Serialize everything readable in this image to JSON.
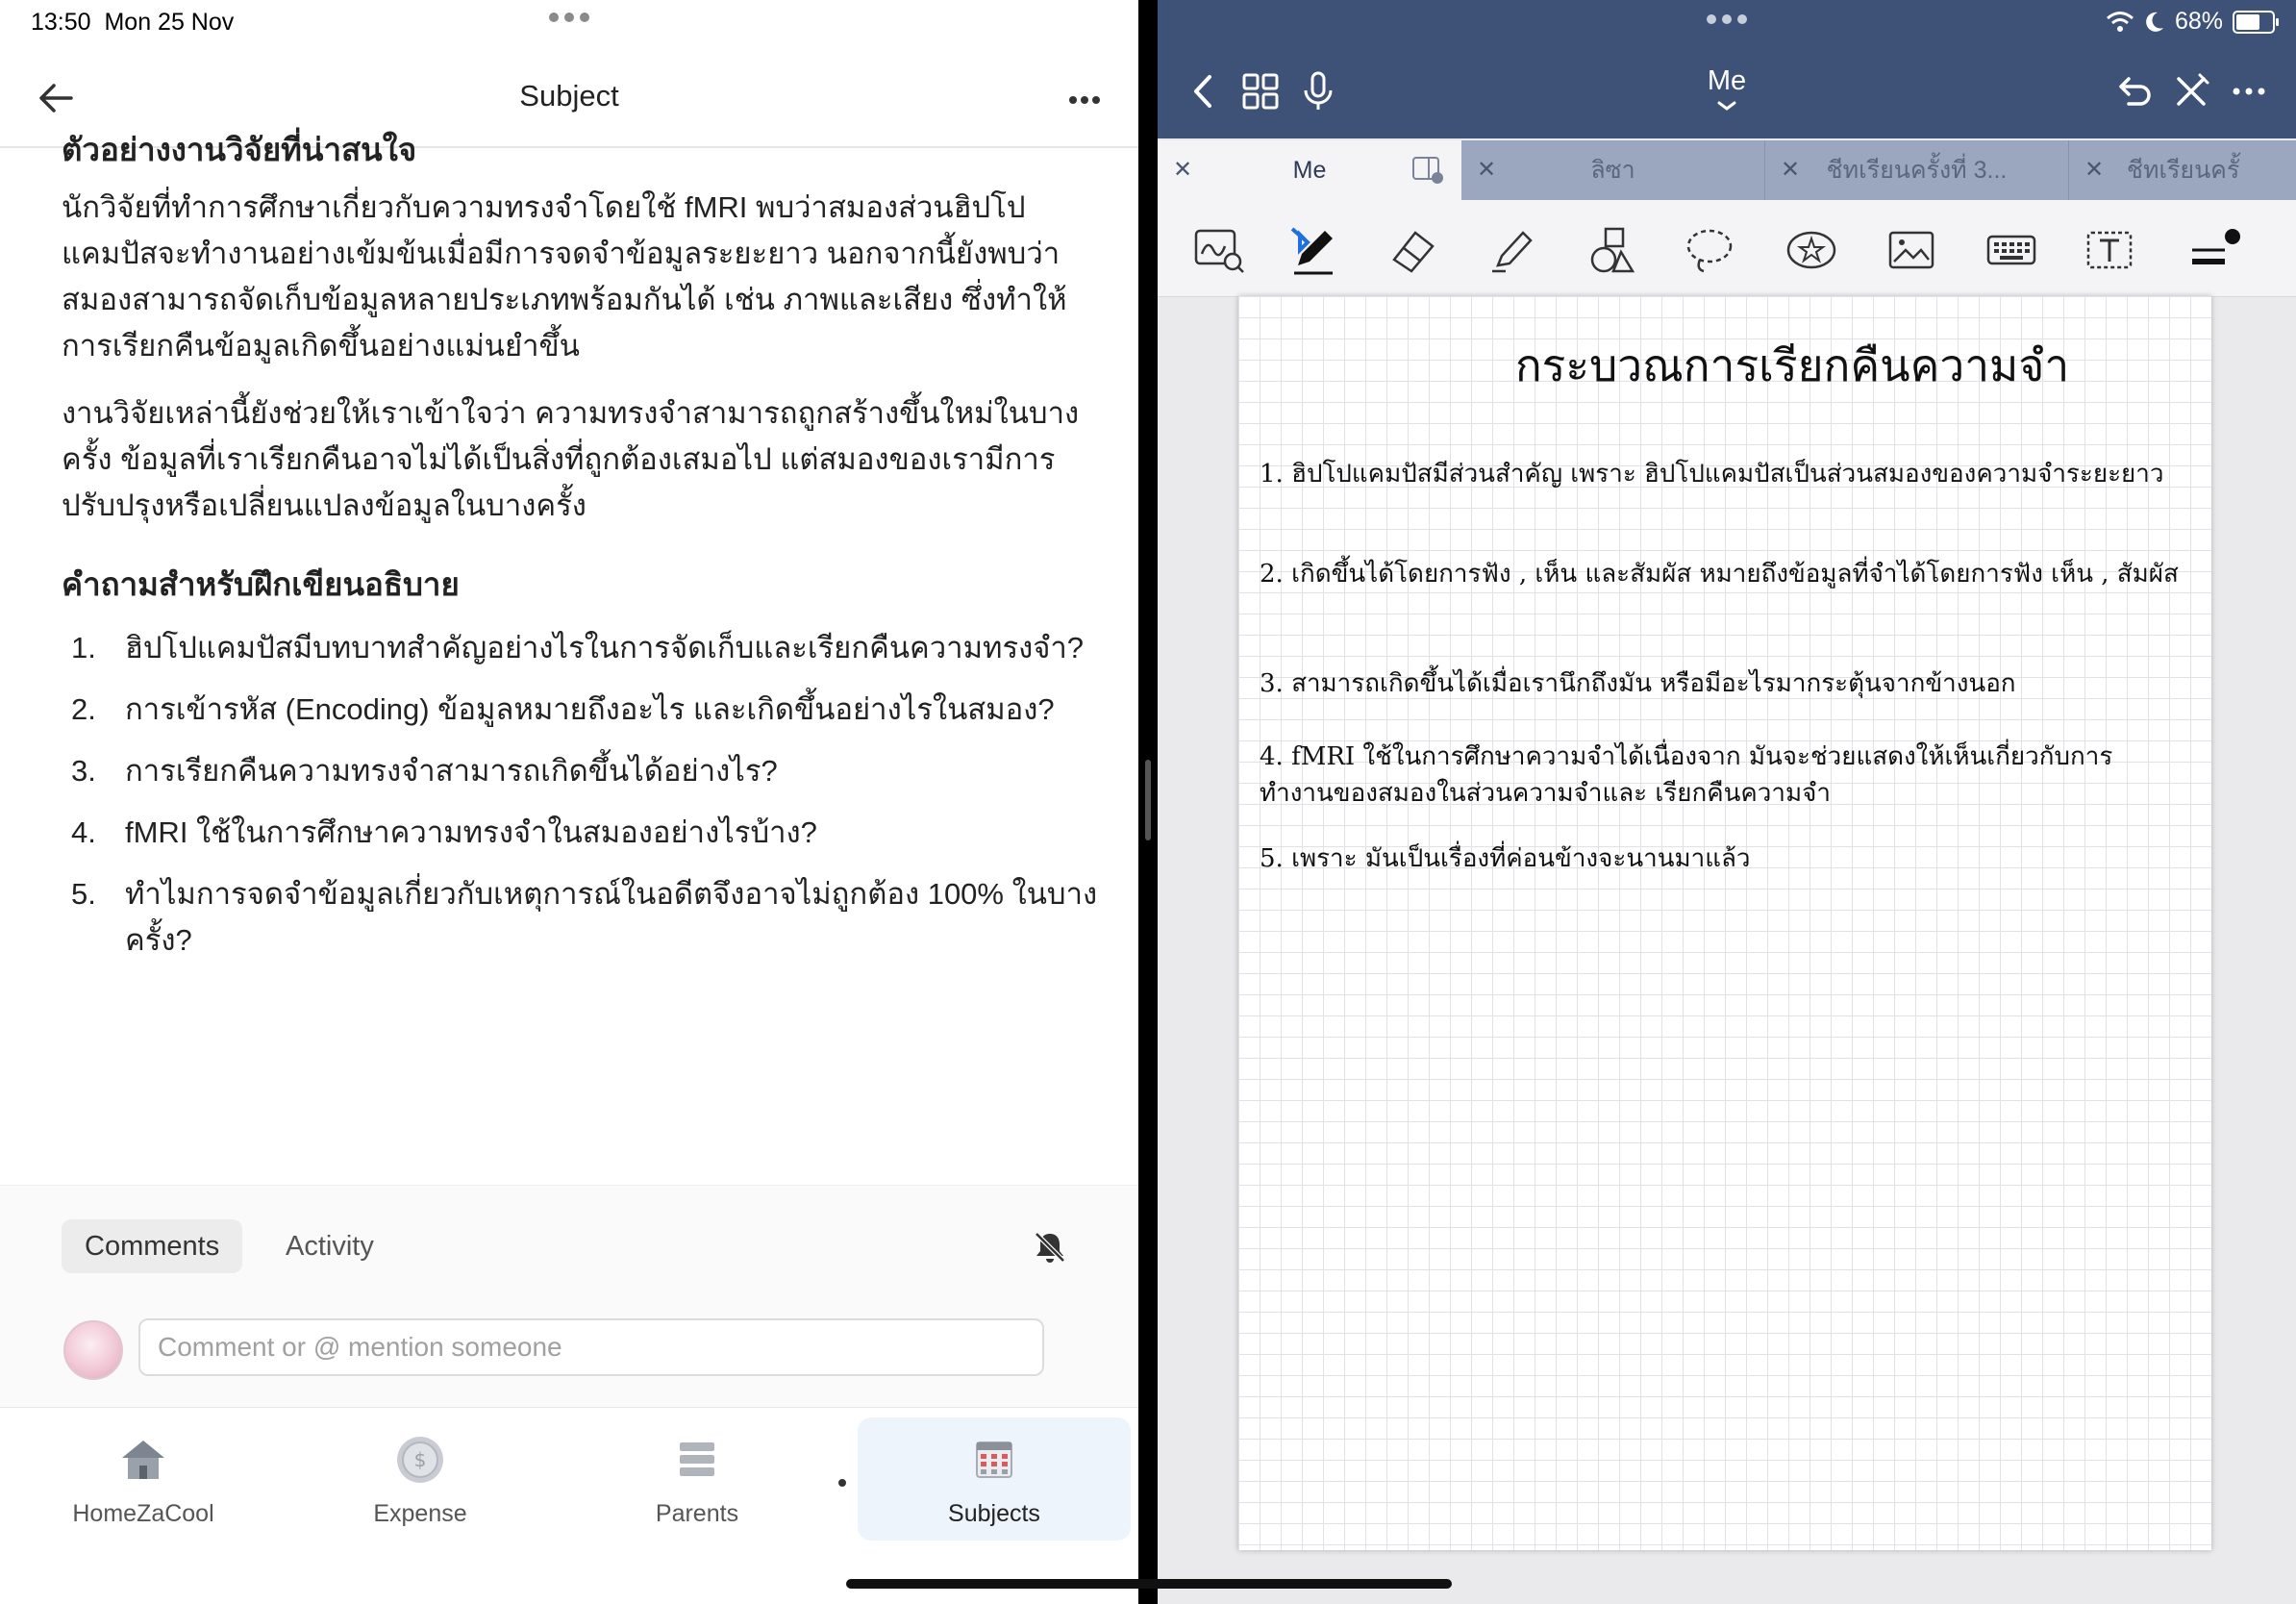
{
  "status": {
    "time": "13:50",
    "date": "Mon 25 Nov",
    "battery": "68%"
  },
  "left": {
    "title": "Subject",
    "section_heading_partial": "ตัวอย่างงานวิจัยที่น่าสนใจ",
    "paragraphs": [
      "นักวิจัยที่ทำการศึกษาเกี่ยวกับความทรงจำโดยใช้ fMRI พบว่าสมองส่วนฮิปโปแคมปัสจะทำงานอย่างเข้มข้นเมื่อมีการจดจำข้อมูลระยะยาว นอกจากนี้ยังพบว่าสมองสามารถจัดเก็บข้อมูลหลายประเภทพร้อมกันได้ เช่น ภาพและเสียง ซึ่งทำให้การเรียกคืนข้อมูลเกิดขึ้นอย่างแม่นยำขึ้น",
      "งานวิจัยเหล่านี้ยังช่วยให้เราเข้าใจว่า ความทรงจำสามารถถูกสร้างขึ้นใหม่ในบางครั้ง ข้อมูลที่เราเรียกคืนอาจไม่ได้เป็นสิ่งที่ถูกต้องเสมอไป แต่สมองของเรามีการปรับปรุงหรือเปลี่ยนแปลงข้อมูลในบางครั้ง"
    ],
    "questions_heading": "คำถามสำหรับฝึกเขียนอธิบาย",
    "questions": [
      {
        "num": "1.",
        "text": "ฮิปโปแคมปัสมีบทบาทสำคัญอย่างไรในการจัดเก็บและเรียกคืนความทรงจำ?"
      },
      {
        "num": "2.",
        "text": "การเข้ารหัส (Encoding) ข้อมูลหมายถึงอะไร และเกิดขึ้นอย่างไรในสมอง?"
      },
      {
        "num": "3.",
        "text": "การเรียกคืนความทรงจำสามารถเกิดขึ้นได้อย่างไร?"
      },
      {
        "num": "4.",
        "text": "fMRI ใช้ในการศึกษาความทรงจำในสมองอย่างไรบ้าง?"
      },
      {
        "num": "5.",
        "text": "ทำไมการจดจำข้อมูลเกี่ยวกับเหตุการณ์ในอดีตจึงอาจไม่ถูกต้อง 100% ในบางครั้ง?"
      }
    ],
    "comments_tab": "Comments",
    "activity_tab": "Activity",
    "comment_placeholder": "Comment or @ mention someone",
    "bottom_nav": [
      {
        "label": "HomeZaCool",
        "icon": "home-icon"
      },
      {
        "label": "Expense",
        "icon": "coin-icon"
      },
      {
        "label": "Parents",
        "icon": "list-icon"
      },
      {
        "label": "Subjects",
        "icon": "calendar-grid-icon",
        "active": true
      }
    ]
  },
  "right": {
    "title": "Me",
    "tabs": [
      {
        "label": "Me",
        "active": true
      },
      {
        "label": "ลิซา"
      },
      {
        "label": "ชีทเรียนครั้งที่ 3..."
      },
      {
        "label": "ชีทเรียนครั้"
      }
    ],
    "note_title": "กระบวณการเรียกคืนความจำ",
    "notes": [
      "1. ฮิปโปแคมปัสมีส่วนสำคัญ เพราะ ฮิปโปแคมปัสเป็นส่วนสมองของความจำระยะยาว",
      "2. เกิดขึ้นได้โดยการฟัง , เห็น และสัมผัส หมายถึงข้อมูลที่จำได้โดยการฟัง เห็น , สัมผัส",
      "3. สามารถเกิดขึ้นได้เมื่อเรานึกถึงมัน หรือมีอะไรมากระตุ้นจากข้างนอก",
      "4. fMRI ใช้ในการศึกษาความจำได้เนื่องจาก มันจะช่วยแสดงให้เห็นเกี่ยวกับการทำงานของสมองในส่วนความจำและ เรียกคืนความจำ",
      "5. เพราะ มันเป็นเรื่องที่ค่อนข้างจะนานมาแล้ว"
    ]
  },
  "colors": {
    "header": "#3e5176",
    "tabs": "#9aa7bf",
    "accent_active": "#eef4fb"
  }
}
